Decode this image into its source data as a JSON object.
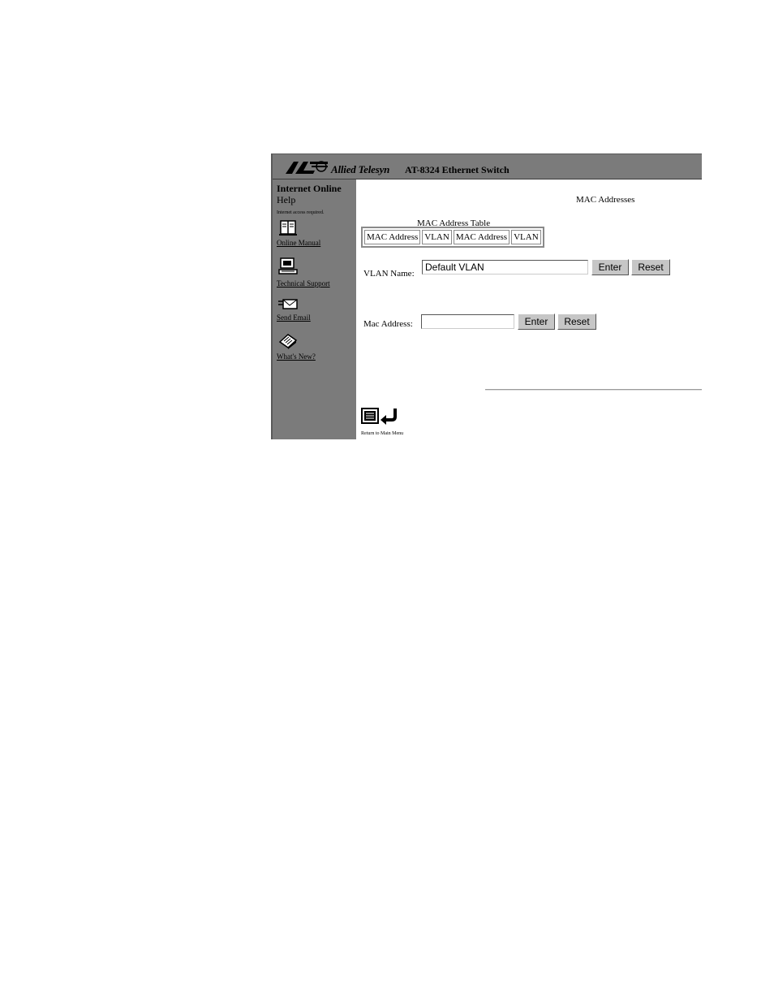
{
  "header": {
    "brand": "Allied Telesyn",
    "product": "AT-8324 Ethernet Switch"
  },
  "sidebar": {
    "help_title_line1": "Internet Online",
    "help_title_line2": "Help",
    "help_note": "Internet access required.",
    "items": [
      {
        "label": "Online Manual",
        "icon": "book-icon"
      },
      {
        "label": "Technical Support",
        "icon": "computer-icon"
      },
      {
        "label": "Send Email",
        "icon": "envelope-icon"
      },
      {
        "label": "What's New?",
        "icon": "news-icon"
      }
    ]
  },
  "main": {
    "title": "MAC Addresses",
    "table_caption": "MAC Address Table",
    "table_headers": [
      "MAC Address",
      "VLAN",
      "MAC Address",
      "VLAN"
    ],
    "vlan_form": {
      "label": "VLAN Name:",
      "value": "Default VLAN",
      "enter_label": "Enter",
      "reset_label": "Reset"
    },
    "mac_form": {
      "label": "Mac Address:",
      "value": "",
      "enter_label": "Enter",
      "reset_label": "Reset"
    },
    "return_label": "Return to Main Menu"
  },
  "colors": {
    "panel_gray": "#7b7b7b",
    "button_gray": "#c6c6c6"
  }
}
